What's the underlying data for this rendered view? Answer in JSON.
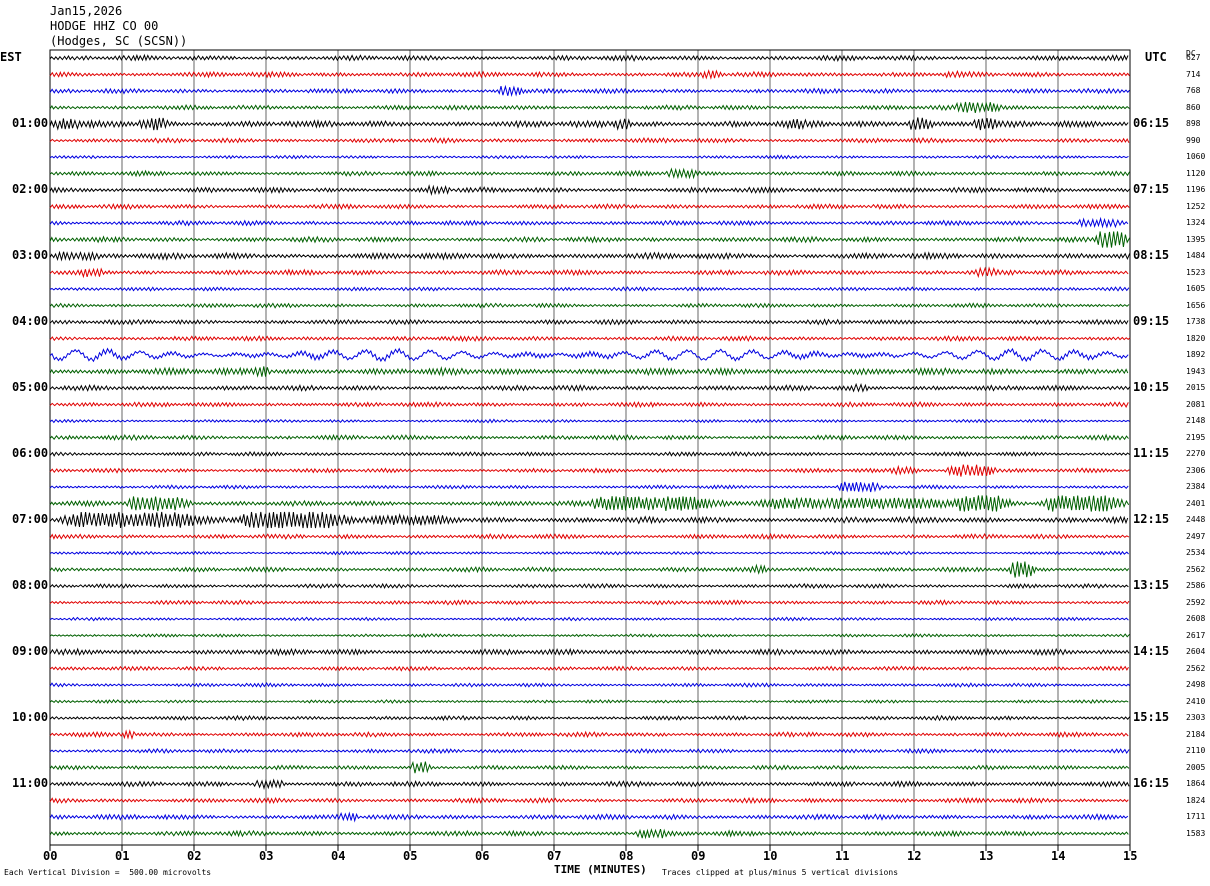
{
  "header": {
    "date": "Jan15,2026",
    "station": "HODGE HHZ CO 00",
    "location": "(Hodges, SC (SCSN))"
  },
  "left_corner_label": "EST",
  "right_corner_label": "UTC",
  "dc_header": "DC",
  "x_axis_title": "TIME (MINUTES)",
  "footer": {
    "scale_note": "Each Vertical Division =  500.00 microvolts",
    "clip_note": "Traces clipped at plus/minus 5 vertical divisions"
  },
  "colors": {
    "trace_cycle": [
      "#000000",
      "#e00000",
      "#0000e0",
      "#006000"
    ],
    "grid": "#000000"
  },
  "chart_data": {
    "type": "line",
    "title": "",
    "x_axis": {
      "label": "TIME (MINUTES)",
      "range": [
        0,
        15
      ],
      "ticks": [
        "00",
        "01",
        "02",
        "03",
        "04",
        "05",
        "06",
        "07",
        "08",
        "09",
        "10",
        "11",
        "12",
        "13",
        "14",
        "15"
      ]
    },
    "left_time_labels": [
      {
        "row": 4,
        "text": "01:00"
      },
      {
        "row": 8,
        "text": "02:00"
      },
      {
        "row": 12,
        "text": "03:00"
      },
      {
        "row": 16,
        "text": "04:00"
      },
      {
        "row": 20,
        "text": "05:00"
      },
      {
        "row": 24,
        "text": "06:00"
      },
      {
        "row": 28,
        "text": "07:00"
      },
      {
        "row": 32,
        "text": "08:00"
      },
      {
        "row": 36,
        "text": "09:00"
      },
      {
        "row": 40,
        "text": "10:00"
      },
      {
        "row": 44,
        "text": "11:00"
      }
    ],
    "right_time_labels": [
      {
        "row": 4,
        "text": "06:15"
      },
      {
        "row": 8,
        "text": "07:15"
      },
      {
        "row": 12,
        "text": "08:15"
      },
      {
        "row": 16,
        "text": "09:15"
      },
      {
        "row": 20,
        "text": "10:15"
      },
      {
        "row": 24,
        "text": "11:15"
      },
      {
        "row": 28,
        "text": "12:15"
      },
      {
        "row": 32,
        "text": "13:15"
      },
      {
        "row": 36,
        "text": "14:15"
      },
      {
        "row": 40,
        "text": "15:15"
      },
      {
        "row": 44,
        "text": "16:15"
      }
    ],
    "dc_offsets": [
      "627",
      "714",
      "768",
      "860",
      "898",
      "990",
      "1060",
      "1120",
      "1196",
      "1252",
      "1324",
      "1395",
      "1484",
      "1523",
      "1605",
      "1656",
      "1738",
      "1820",
      "1892",
      "1943",
      "2015",
      "2081",
      "2148",
      "2195",
      "2270",
      "2306",
      "2384",
      "2401",
      "2448",
      "2497",
      "2534",
      "2562",
      "2586",
      "2592",
      "2608",
      "2617",
      "2604",
      "2562",
      "2498",
      "2410",
      "2303",
      "2184",
      "2110",
      "2005",
      "1864",
      "1824",
      "1711",
      "1583"
    ],
    "traces": [
      {
        "row": 0,
        "amp": 1.0,
        "events": []
      },
      {
        "row": 1,
        "amp": 1.0,
        "events": [
          {
            "start": 9.0,
            "end": 9.4,
            "amp": 1.8
          },
          {
            "start": 12.4,
            "end": 12.7,
            "amp": 1.6
          }
        ]
      },
      {
        "row": 2,
        "amp": 0.9,
        "events": [
          {
            "start": 6.2,
            "end": 6.6,
            "amp": 2.5
          }
        ]
      },
      {
        "row": 3,
        "amp": 0.9,
        "events": [
          {
            "start": 12.5,
            "end": 13.3,
            "amp": 2.5
          }
        ]
      },
      {
        "row": 4,
        "amp": 1.3,
        "events": [
          {
            "start": 0.0,
            "end": 0.5,
            "amp": 2.5
          },
          {
            "start": 1.2,
            "end": 1.7,
            "amp": 2.8
          },
          {
            "start": 7.8,
            "end": 8.1,
            "amp": 2.5
          },
          {
            "start": 10.2,
            "end": 10.6,
            "amp": 2.5
          },
          {
            "start": 11.9,
            "end": 12.3,
            "amp": 3.0
          },
          {
            "start": 12.8,
            "end": 13.2,
            "amp": 3.0
          }
        ]
      },
      {
        "row": 5,
        "amp": 0.9,
        "events": []
      },
      {
        "row": 6,
        "amp": 0.6,
        "events": []
      },
      {
        "row": 7,
        "amp": 0.9,
        "events": [
          {
            "start": 8.5,
            "end": 9.1,
            "amp": 2.0
          }
        ]
      },
      {
        "row": 8,
        "amp": 1.0,
        "events": [
          {
            "start": 5.2,
            "end": 5.6,
            "amp": 2.0
          }
        ]
      },
      {
        "row": 9,
        "amp": 0.9,
        "events": []
      },
      {
        "row": 10,
        "amp": 0.9,
        "events": [
          {
            "start": 14.2,
            "end": 15.0,
            "amp": 2.0
          }
        ]
      },
      {
        "row": 11,
        "amp": 1.0,
        "events": [
          {
            "start": 14.5,
            "end": 15.0,
            "amp": 4.5
          }
        ]
      },
      {
        "row": 12,
        "amp": 1.2,
        "events": [
          {
            "start": 0.0,
            "end": 0.8,
            "amp": 2.0
          }
        ]
      },
      {
        "row": 13,
        "amp": 1.0,
        "events": [
          {
            "start": 0.4,
            "end": 0.8,
            "amp": 2.0
          },
          {
            "start": 12.8,
            "end": 13.2,
            "amp": 2.0
          }
        ]
      },
      {
        "row": 14,
        "amp": 0.7,
        "events": []
      },
      {
        "row": 15,
        "amp": 0.8,
        "events": []
      },
      {
        "row": 16,
        "amp": 0.9,
        "events": []
      },
      {
        "row": 17,
        "amp": 0.9,
        "events": []
      },
      {
        "row": 18,
        "amp": 1.0,
        "swell": 4.5,
        "events": []
      },
      {
        "row": 19,
        "amp": 1.3,
        "events": [
          {
            "start": 2.8,
            "end": 3.1,
            "amp": 2.4
          }
        ]
      },
      {
        "row": 20,
        "amp": 1.0,
        "events": [
          {
            "start": 11.1,
            "end": 11.4,
            "amp": 2.2
          }
        ]
      },
      {
        "row": 21,
        "amp": 0.9,
        "events": []
      },
      {
        "row": 22,
        "amp": 0.6,
        "events": []
      },
      {
        "row": 23,
        "amp": 0.9,
        "events": []
      },
      {
        "row": 24,
        "amp": 0.8,
        "events": []
      },
      {
        "row": 25,
        "amp": 0.8,
        "events": [
          {
            "start": 11.6,
            "end": 12.1,
            "amp": 1.8
          },
          {
            "start": 12.4,
            "end": 13.2,
            "amp": 2.8
          }
        ]
      },
      {
        "row": 26,
        "amp": 0.7,
        "events": [
          {
            "start": 10.9,
            "end": 11.6,
            "amp": 2.5
          }
        ]
      },
      {
        "row": 27,
        "amp": 1.0,
        "events": [
          {
            "start": 1.0,
            "end": 2.0,
            "amp": 3.6
          },
          {
            "start": 7.3,
            "end": 9.5,
            "amp": 3.4
          },
          {
            "start": 9.5,
            "end": 13.0,
            "amp": 2.6
          },
          {
            "start": 12.5,
            "end": 13.4,
            "amp": 4.2
          },
          {
            "start": 13.7,
            "end": 15.0,
            "amp": 4.0
          }
        ]
      },
      {
        "row": 28,
        "amp": 1.2,
        "events": [
          {
            "start": 0.0,
            "end": 2.4,
            "amp": 3.8
          },
          {
            "start": 2.5,
            "end": 4.3,
            "amp": 4.2
          },
          {
            "start": 4.3,
            "end": 5.8,
            "amp": 2.4
          }
        ]
      },
      {
        "row": 29,
        "amp": 0.9,
        "events": []
      },
      {
        "row": 30,
        "amp": 0.6,
        "events": []
      },
      {
        "row": 31,
        "amp": 0.9,
        "events": [
          {
            "start": 9.7,
            "end": 10.0,
            "amp": 2.0
          },
          {
            "start": 13.3,
            "end": 13.7,
            "amp": 4.0
          }
        ]
      },
      {
        "row": 32,
        "amp": 0.8,
        "events": []
      },
      {
        "row": 33,
        "amp": 0.8,
        "events": []
      },
      {
        "row": 34,
        "amp": 0.6,
        "events": []
      },
      {
        "row": 35,
        "amp": 0.6,
        "events": []
      },
      {
        "row": 36,
        "amp": 1.1,
        "events": []
      },
      {
        "row": 37,
        "amp": 0.8,
        "events": []
      },
      {
        "row": 38,
        "amp": 0.7,
        "events": []
      },
      {
        "row": 39,
        "amp": 0.6,
        "events": []
      },
      {
        "row": 40,
        "amp": 0.8,
        "events": []
      },
      {
        "row": 41,
        "amp": 0.9,
        "events": [
          {
            "start": 1.0,
            "end": 1.2,
            "amp": 2.0
          }
        ]
      },
      {
        "row": 42,
        "amp": 0.8,
        "events": []
      },
      {
        "row": 43,
        "amp": 0.8,
        "events": [
          {
            "start": 5.0,
            "end": 5.3,
            "amp": 3.0
          }
        ]
      },
      {
        "row": 44,
        "amp": 1.0,
        "events": [
          {
            "start": 2.8,
            "end": 3.3,
            "amp": 2.2
          }
        ]
      },
      {
        "row": 45,
        "amp": 0.9,
        "events": []
      },
      {
        "row": 46,
        "amp": 1.0,
        "events": [
          {
            "start": 4.0,
            "end": 4.3,
            "amp": 2.0
          }
        ]
      },
      {
        "row": 47,
        "amp": 1.0,
        "events": [
          {
            "start": 8.1,
            "end": 8.7,
            "amp": 2.2
          }
        ]
      }
    ]
  }
}
